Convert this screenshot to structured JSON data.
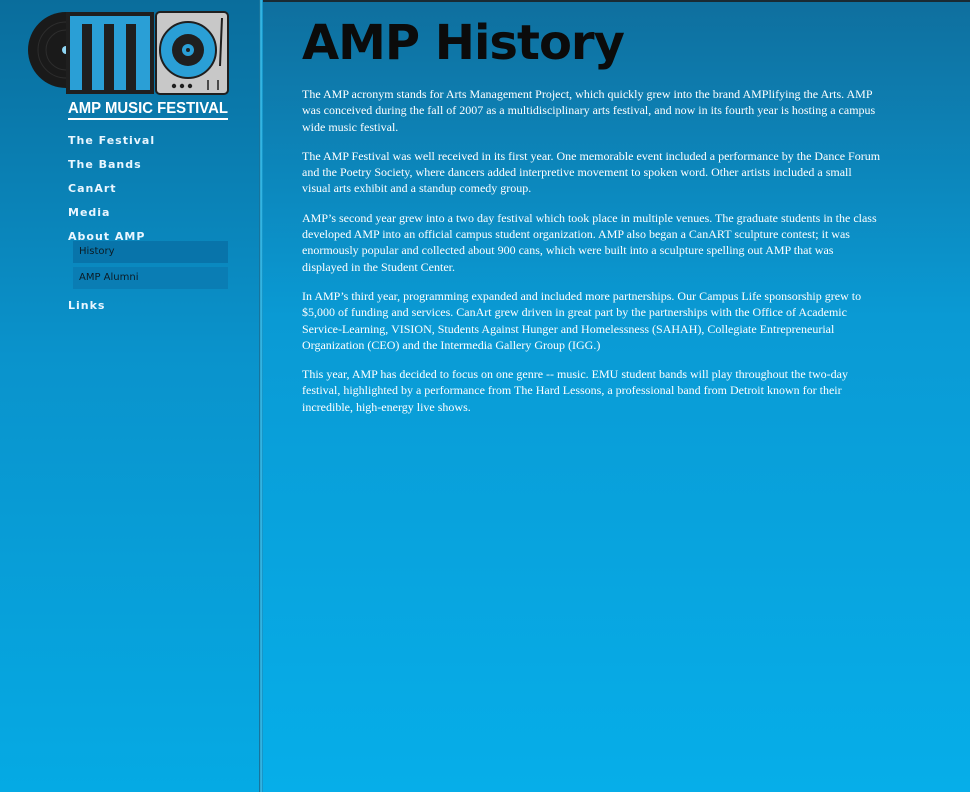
{
  "logo": {
    "caption": "AMP MUSIC FESTIVAL"
  },
  "nav": {
    "festival": "The Festival",
    "bands": "The Bands",
    "canart": "CanArt",
    "media": "Media",
    "about": "About AMP",
    "sub_history": "History",
    "sub_alumni": "AMP Alumni",
    "links": "Links"
  },
  "page": {
    "title": "AMP History",
    "paragraphs": [
      "The AMP acronym stands for Arts Management Project, which quickly grew into the brand AMPlifying the Arts. AMP was conceived during the fall of 2007 as a multidisciplinary arts festival, and now in its fourth year is hosting a campus wide music festival.",
      "The AMP Festival was well received in its first year. One memorable event included a performance by the Dance Forum and the Poetry Society, where dancers added interpretive movement to spoken word. Other artists included a small visual arts exhibit and a standup comedy group.",
      "AMP’s second year grew into a two day festival which took place in multiple venues. The graduate students in the class developed AMP into an official campus student organization. AMP also began a CanART sculpture contest; it was enormously popular and collected about 900 cans, which were built into a sculpture spelling out AMP that was displayed in the Student Center.",
      "In AMP’s third year, programming expanded and included more partnerships. Our Campus Life sponsorship grew to $5,000 of funding and services. CanArt grew driven in great part by the partnerships with the Office of Academic Service-Learning, VISION, Students Against Hunger and Homelessness (SAHAH), Collegiate Entrepreneurial Organization (CEO) and the Intermedia Gallery Group (IGG.)",
      "This year, AMP has decided to focus on one genre -- music. EMU student bands will play throughout the two-day festival, highlighted by a performance from The Hard Lessons, a professional band from Detroit known for their incredible, high-energy live shows."
    ]
  },
  "colors": {
    "accent": "#0a9ad4",
    "title": "#0b0b0b",
    "logo_blue": "#2a9fd6"
  }
}
